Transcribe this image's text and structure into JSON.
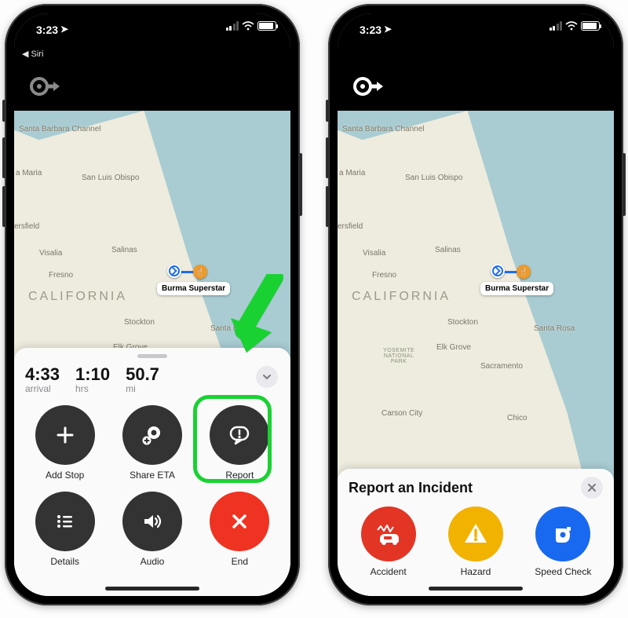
{
  "status": {
    "time": "3:23",
    "back_app": "Siri"
  },
  "map": {
    "region_label": "CALIFORNIA",
    "cities": [
      "Santa Barbara Channel",
      "a Maria",
      "San Luis Obispo",
      "ersfield",
      "Visalia",
      "Salinas",
      "Fresno",
      "Stockton",
      "Elk Grove",
      "Santa Rosa",
      "Sacramento",
      "Carson City",
      "Chico"
    ],
    "park": "YOSEMITE NATIONAL PARK",
    "poi_label": "Burma Superstar"
  },
  "card": {
    "stats": [
      {
        "value": "4:33",
        "label": "arrival"
      },
      {
        "value": "1:10",
        "label": "hrs"
      },
      {
        "value": "50.7",
        "label": "mi"
      }
    ],
    "actions": [
      {
        "name": "add-stop",
        "label": "Add Stop"
      },
      {
        "name": "share-eta",
        "label": "Share ETA"
      },
      {
        "name": "report",
        "label": "Report"
      },
      {
        "name": "details",
        "label": "Details"
      },
      {
        "name": "audio",
        "label": "Audio"
      },
      {
        "name": "end",
        "label": "End"
      }
    ]
  },
  "incident": {
    "title": "Report an Incident",
    "options": [
      {
        "name": "accident",
        "label": "Accident"
      },
      {
        "name": "hazard",
        "label": "Hazard"
      },
      {
        "name": "speed-check",
        "label": "Speed Check"
      }
    ]
  }
}
